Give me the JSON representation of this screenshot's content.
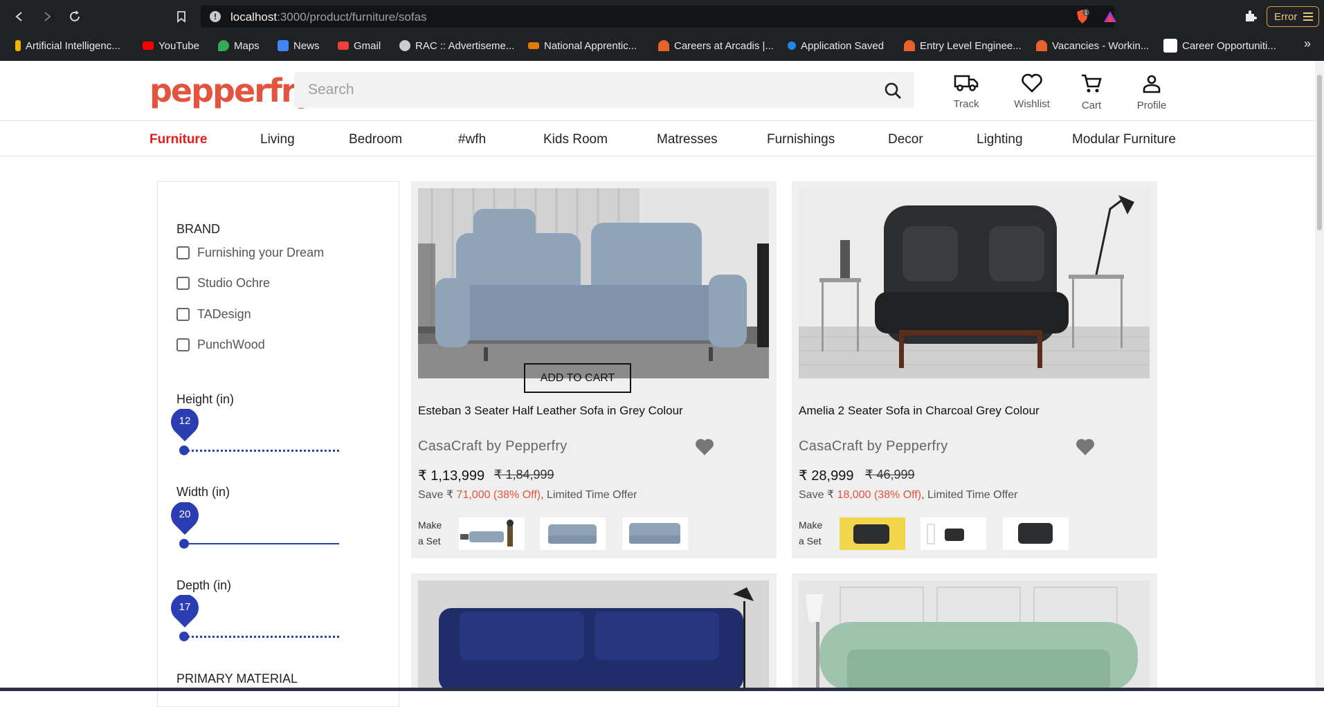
{
  "browser": {
    "url_host": "localhost",
    "url_path": ":3000/product/furniture/sofas",
    "error_label": "Error",
    "shield_badge": "1",
    "bookmarks": [
      {
        "label": "Artificial Intelligenc...",
        "color": "#f0b400"
      },
      {
        "label": "YouTube",
        "color": "#ff0000"
      },
      {
        "label": "Maps",
        "color": "#34a853"
      },
      {
        "label": "News",
        "color": "#4285f4"
      },
      {
        "label": "Gmail",
        "color": "#ea4335"
      },
      {
        "label": "RAC :: Advertiseme...",
        "color": "#cccccc"
      },
      {
        "label": "National Apprentic...",
        "color": "#e07b00"
      },
      {
        "label": "Careers at Arcadis |...",
        "color": "#e8622b"
      },
      {
        "label": "Application Saved",
        "color": "#1e88e5"
      },
      {
        "label": "Entry Level Enginee...",
        "color": "#e8622b"
      },
      {
        "label": "Vacancies - Workin...",
        "color": "#e8622b"
      },
      {
        "label": "Career Opportuniti...",
        "color": "#ffffff"
      }
    ],
    "more": "»"
  },
  "header": {
    "logo": "pepperfry",
    "search_placeholder": "Search",
    "actions": [
      {
        "label": "Track",
        "icon": "truck-icon"
      },
      {
        "label": "Wishlist",
        "icon": "heart-icon"
      },
      {
        "label": "Cart",
        "icon": "cart-icon"
      },
      {
        "label": "Profile",
        "icon": "user-icon"
      }
    ]
  },
  "categories": [
    "Furniture",
    "Living",
    "Bedroom",
    "#wfh",
    "Kids Room",
    "Matresses",
    "Furnishings",
    "Decor",
    "Lighting",
    "Modular Furniture"
  ],
  "active_category": "Furniture",
  "filters": {
    "brand_title": "BRAND",
    "brands": [
      "Furnishing your Dream",
      "Studio Ochre",
      "TADesign",
      "PunchWood"
    ],
    "sliders": [
      {
        "label": "Height (in)",
        "value": "12"
      },
      {
        "label": "Width (in)",
        "value": "20"
      },
      {
        "label": "Depth (in)",
        "value": "17"
      }
    ],
    "primary_material_title": "PRIMARY MATERIAL"
  },
  "products": [
    {
      "name": "Esteban 3 Seater Half Leather Sofa in Grey Colour",
      "brand": "CasaCraft by Pepperfry",
      "price": "₹ 1,13,999",
      "mrp": "₹ 1,84,999",
      "save_prefix": "Save ₹ ",
      "save_amount": "71,000 (38% Off)",
      "save_suffix": ", Limited Time Offer",
      "make_set": "Make a Set",
      "add_to_cart": "ADD TO CART",
      "sofa_color": "#8fa3b9"
    },
    {
      "name": "Amelia 2 Seater Sofa in Charcoal Grey Colour",
      "brand": "CasaCraft by Pepperfry",
      "price": "₹ 28,999",
      "mrp": "₹ 46,999",
      "save_prefix": "Save ₹ ",
      "save_amount": "18,000 (38% Off)",
      "save_suffix": ", Limited Time Offer",
      "make_set": "Make a Set",
      "sofa_color": "#2b2d2e"
    }
  ],
  "colors": {
    "accent_red": "#e21d1d",
    "slider_blue": "#2b3db3",
    "offer_red": "#e2543e"
  }
}
